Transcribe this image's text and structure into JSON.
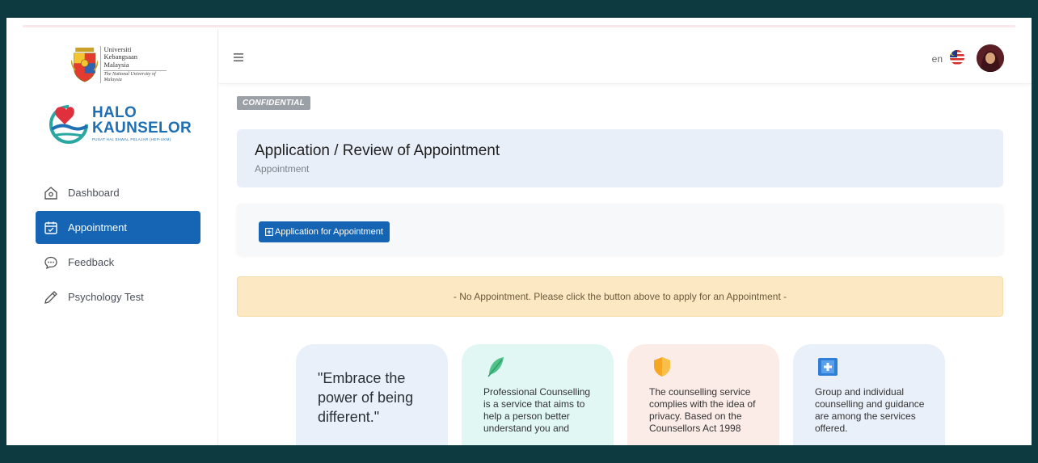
{
  "university": {
    "name_line1": "Universiti",
    "name_line2": "Kebangsaan",
    "name_line3": "Malaysia",
    "tagline": "The National University of Malaysia"
  },
  "brand": {
    "title_line1": "HALO",
    "title_line2": "KAUNSELOR",
    "subtitle": "PUSAT HAL EHWAL PELAJAR (HEP-UKM)",
    "primary_color": "#1565b4"
  },
  "sidebar": {
    "items": [
      {
        "label": "Dashboard",
        "icon": "home-icon",
        "active": false
      },
      {
        "label": "Appointment",
        "icon": "calendar-check-icon",
        "active": true
      },
      {
        "label": "Feedback",
        "icon": "chat-bubble-icon",
        "active": false
      },
      {
        "label": "Psychology Test",
        "icon": "pen-icon",
        "active": false
      }
    ]
  },
  "header": {
    "menu_icon": "hamburger-icon",
    "language": "en",
    "flag_icon": "malaysia-flag-icon",
    "avatar_icon": "user-avatar"
  },
  "main": {
    "badge": "CONFIDENTIAL",
    "title": "Application / Review of Appointment",
    "breadcrumb": "Appointment",
    "apply_button": "Application for Appointment",
    "alert": "- No Appointment. Please click the button above to apply for an Appointment -",
    "alert_color": "#fce8c3"
  },
  "info_cards": [
    {
      "text": "\"Embrace the power of being different.\""
    },
    {
      "text": "Professional Counselling is a service that aims to help a person better understand you and",
      "icon": "feather-icon"
    },
    {
      "text": "The counselling service complies with the idea of privacy. Based on the Counsellors Act 1998",
      "icon": "shield-icon"
    },
    {
      "text": "Group and individual counselling and guidance are among the services offered.",
      "icon": "medical-plus-icon"
    }
  ]
}
